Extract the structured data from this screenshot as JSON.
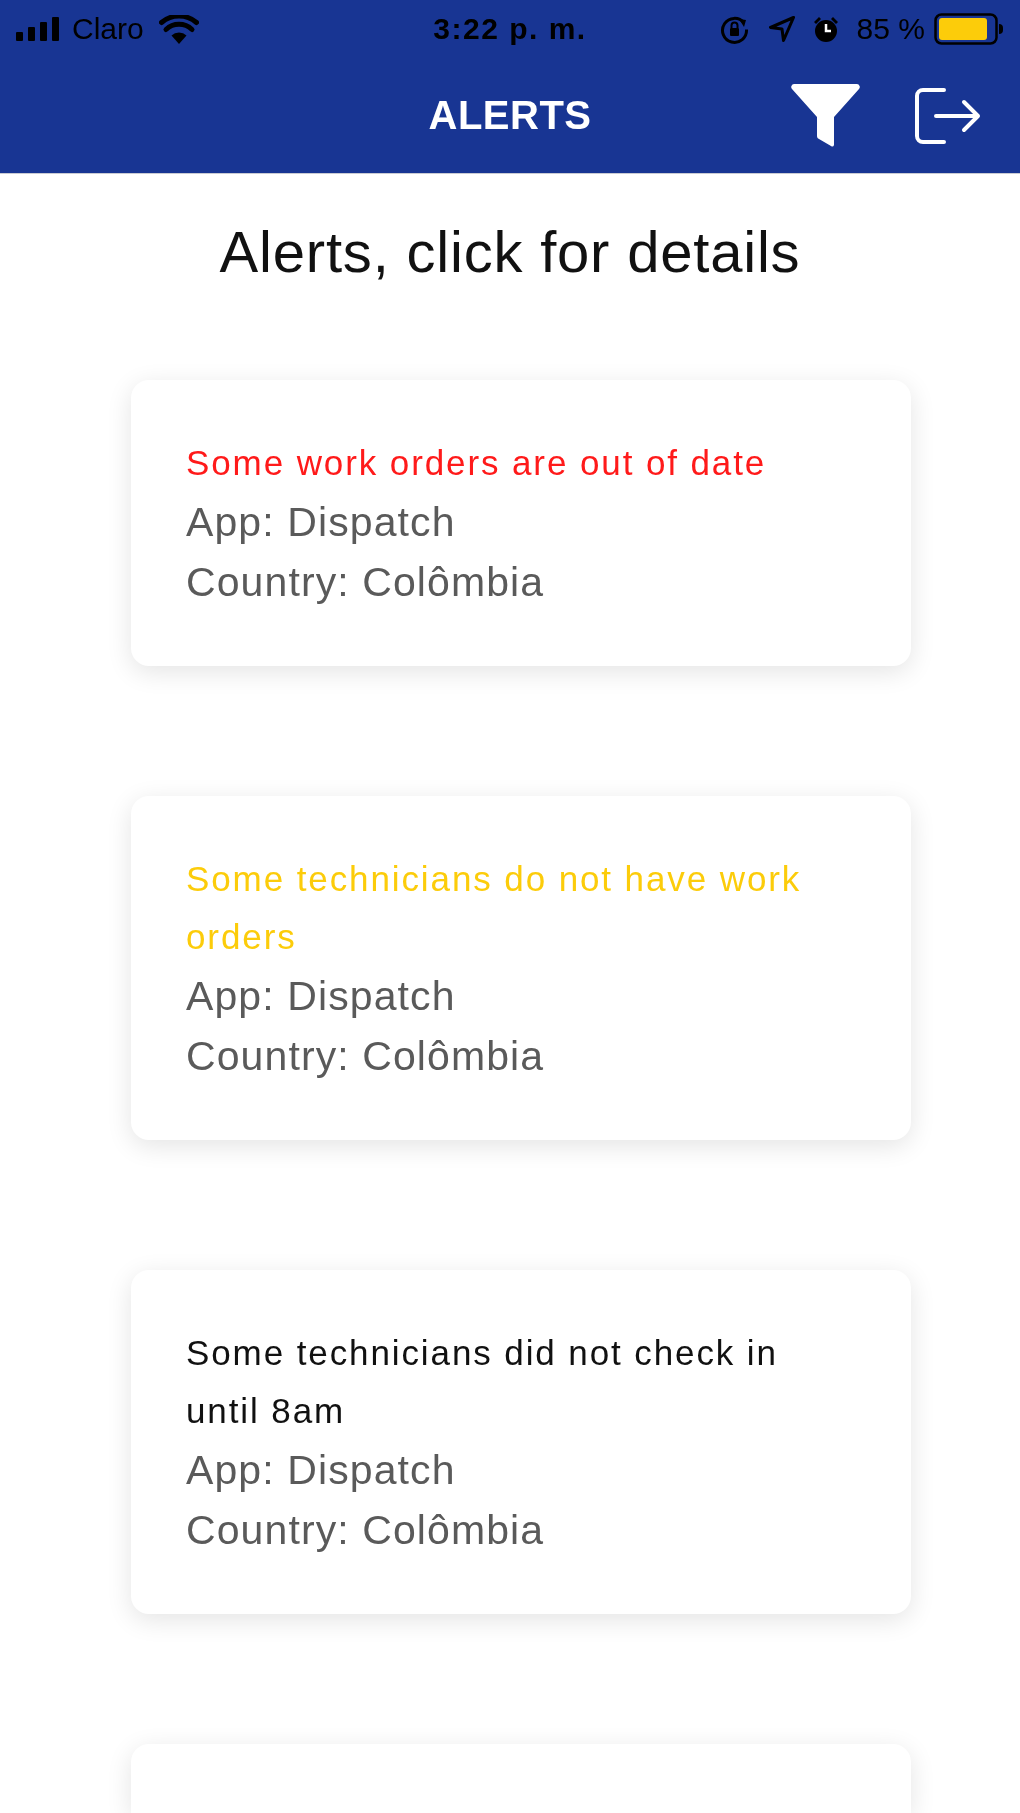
{
  "status_bar": {
    "carrier": "Claro",
    "time": "3:22 p. m.",
    "battery": "85 %"
  },
  "header": {
    "title": "ALERTS"
  },
  "heading": "Alerts, click for details",
  "alerts": [
    {
      "message": "Some work orders are out of date",
      "color": "#ff1a1a",
      "app": "App: Dispatch",
      "country": "Country: Colômbia"
    },
    {
      "message": "Some technicians do not have work orders",
      "color": "#fccc0a",
      "app": "App: Dispatch",
      "country": "Country: Colômbia"
    },
    {
      "message": "Some technicians did not check in until 8am",
      "color": "#111111",
      "app": "App: Dispatch",
      "country": "Country: Colômbia"
    }
  ],
  "list_continues": true
}
